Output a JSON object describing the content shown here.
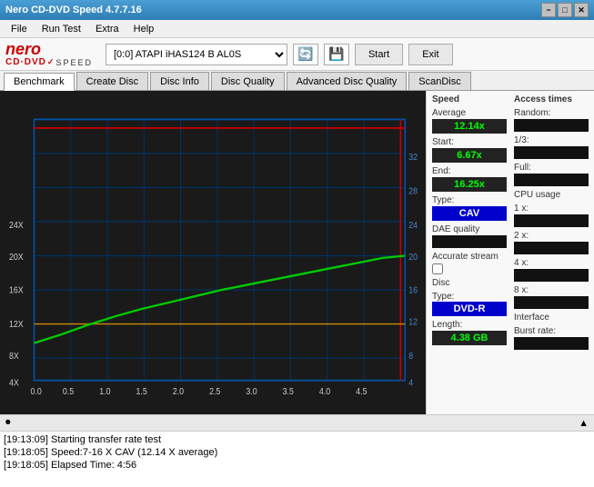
{
  "titlebar": {
    "title": "Nero CD-DVD Speed 4.7.7.16",
    "minimize": "−",
    "maximize": "□",
    "close": "✕"
  },
  "menubar": {
    "items": [
      "File",
      "Run Test",
      "Extra",
      "Help"
    ]
  },
  "toolbar": {
    "drive_value": "[0:0]  ATAPI iHAS124  B AL0S",
    "start_label": "Start",
    "exit_label": "Exit"
  },
  "tabs": {
    "items": [
      "Benchmark",
      "Create Disc",
      "Disc Info",
      "Disc Quality",
      "Advanced Disc Quality",
      "ScanDisc"
    ]
  },
  "chart": {
    "x_labels": [
      "0.0",
      "0.5",
      "1.0",
      "1.5",
      "2.0",
      "2.5",
      "3.0",
      "3.5",
      "4.0",
      "4.5"
    ],
    "y_left_labels": [
      "4X",
      "8X",
      "12X",
      "16X",
      "20X",
      "24X"
    ],
    "y_right_labels": [
      "4",
      "8",
      "12",
      "16",
      "20",
      "24",
      "28",
      "32"
    ]
  },
  "speed_panel": {
    "title": "Speed",
    "average_label": "Average",
    "average_value": "12.14x",
    "start_label": "Start:",
    "start_value": "6.67x",
    "end_label": "End:",
    "end_value": "16.25x",
    "type_label": "Type:",
    "type_value": "CAV",
    "dae_label": "DAE quality",
    "accurate_label": "Accurate stream",
    "disc_label": "Disc",
    "disc_type_label": "Type:",
    "disc_type_value": "DVD-R",
    "length_label": "Length:",
    "length_value": "4.38 GB"
  },
  "access_panel": {
    "title": "Access times",
    "random_label": "Random:",
    "random_value": "",
    "onethird_label": "1/3:",
    "onethird_value": "",
    "full_label": "Full:",
    "full_value": "",
    "cpu_label": "CPU usage",
    "cpu_1x_label": "1 x:",
    "cpu_1x_value": "",
    "cpu_2x_label": "2 x:",
    "cpu_2x_value": "",
    "cpu_4x_label": "4 x:",
    "cpu_4x_value": "",
    "cpu_8x_label": "8 x:",
    "cpu_8x_value": "",
    "interface_label": "Interface",
    "burst_label": "Burst rate:",
    "burst_value": ""
  },
  "log": {
    "entries": [
      "[19:13:09]  Starting transfer rate test",
      "[19:18:05]  Speed:7-16 X CAV (12.14 X average)",
      "[19:18:05]  Elapsed Time: 4:56"
    ]
  }
}
